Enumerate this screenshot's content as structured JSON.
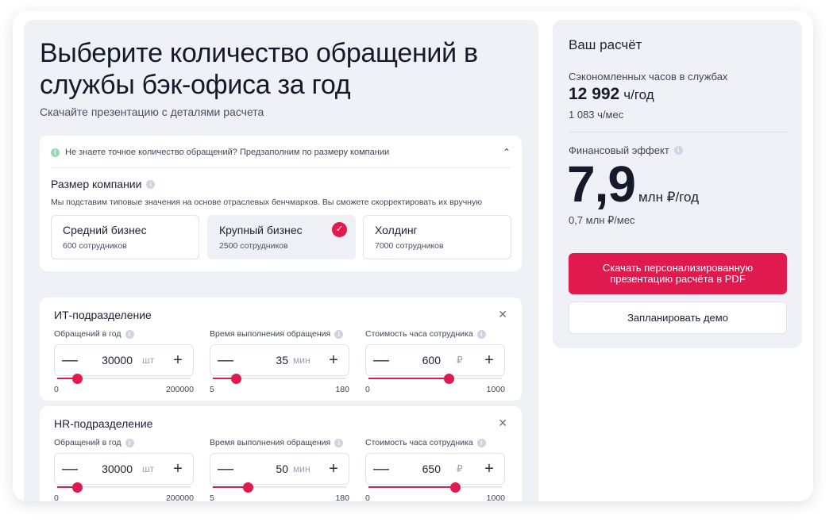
{
  "main": {
    "title": "Выберите количество обращений в службы бэк-офиса за год",
    "subtitle": "Скачайте презентацию с деталями расчета"
  },
  "company_size": {
    "hint": "Не знаете точное количество обращений? Предзаполним по размеру компании",
    "label": "Размер компании",
    "description": "Мы подставим типовые значения на основе отраслевых бенчмарков. Вы сможете скорректировать их вручную",
    "options": [
      {
        "name": "Средний бизнес",
        "sub": "600 сотрудников",
        "selected": false
      },
      {
        "name": "Крупный бизнес",
        "sub": "2500 сотрудников",
        "selected": true
      },
      {
        "name": "Холдинг",
        "sub": "7000 сотрудников",
        "selected": false
      }
    ]
  },
  "departments": [
    {
      "title": "ИТ-подразделение",
      "fields": [
        {
          "label": "Обращений в год",
          "value": "30000",
          "unit": "шт",
          "min": "0",
          "max": "200000",
          "level": 0.15
        },
        {
          "label": "Время выполнения обращения",
          "value": "35",
          "unit": "мин",
          "min": "5",
          "max": "180",
          "level": 0.17
        },
        {
          "label": "Стоимость часа сотрудника",
          "value": "600",
          "unit": "₽",
          "min": "0",
          "max": "1000",
          "level": 0.6
        }
      ]
    },
    {
      "title": "HR-подразделение",
      "fields": [
        {
          "label": "Обращений в год",
          "value": "30000",
          "unit": "шт",
          "min": "0",
          "max": "200000",
          "level": 0.15
        },
        {
          "label": "Время выполнения обращения",
          "value": "50",
          "unit": "мин",
          "min": "5",
          "max": "180",
          "level": 0.26
        },
        {
          "label": "Стоимость часа сотрудника",
          "value": "650",
          "unit": "₽",
          "min": "0",
          "max": "1000",
          "level": 0.65
        }
      ]
    }
  ],
  "result": {
    "title": "Ваш расчёт",
    "hours_label": "Сэкономленных часов в службах",
    "hours_value": "12 992",
    "hours_unit": "ч/год",
    "hours_month": "1 083 ч/мес",
    "fin_label": "Финансовый эффект",
    "fin_value": "7,9",
    "fin_unit": "млн ₽/год",
    "fin_month": "0,7 млн ₽/мес",
    "download_label": "Скачать персонализированную презентацию расчёта в PDF",
    "demo_label": "Запланировать демо"
  },
  "icons": {
    "minus": "—",
    "plus": "+",
    "close": "✕",
    "chevron": "⌃",
    "check": "✓",
    "info": "i"
  },
  "colors": {
    "accent": "#e0194e",
    "panel": "#eff1f6"
  }
}
